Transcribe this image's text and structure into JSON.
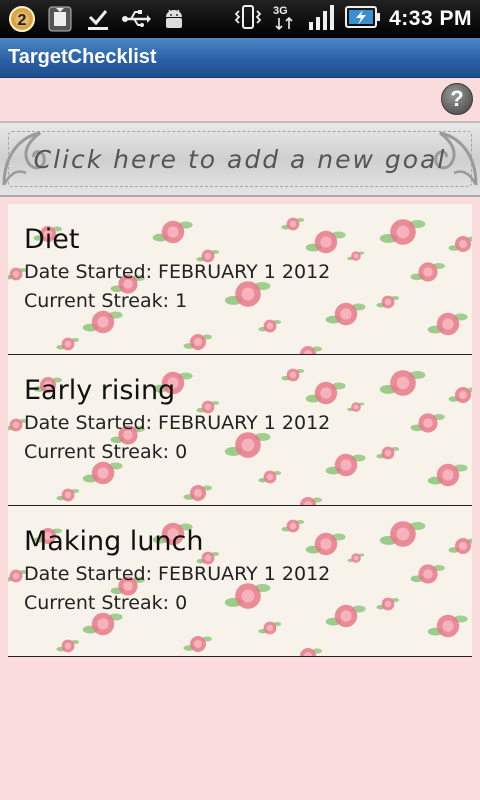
{
  "status_bar": {
    "notification_count": "2",
    "network_label": "3G",
    "time": "4:33 PM",
    "icons": [
      "badge-icon",
      "sim-toolkit-icon",
      "download-complete-icon",
      "usb-icon",
      "android-debug-icon",
      "vibrate-icon",
      "network-3g-icon",
      "signal-icon",
      "battery-charging-icon"
    ]
  },
  "app": {
    "title": "TargetChecklist",
    "help_label": "?",
    "add_goal_label": "Click here to add a new goal"
  },
  "goals": [
    {
      "name": "Diet",
      "date_started": "Date Started: FEBRUARY 1 2012",
      "streak": "Current Streak: 1"
    },
    {
      "name": "Early rising",
      "date_started": "Date Started: FEBRUARY 1 2012",
      "streak": "Current Streak: 0"
    },
    {
      "name": "Making lunch",
      "date_started": "Date Started: FEBRUARY 1 2012",
      "streak": "Current Streak: 0"
    }
  ],
  "colors": {
    "background": "#fbdcdc",
    "title_bar": "#2b62a6",
    "card_background": "#f8f3ea",
    "rose": "#e8788a",
    "leaf": "#7cbf6a"
  }
}
